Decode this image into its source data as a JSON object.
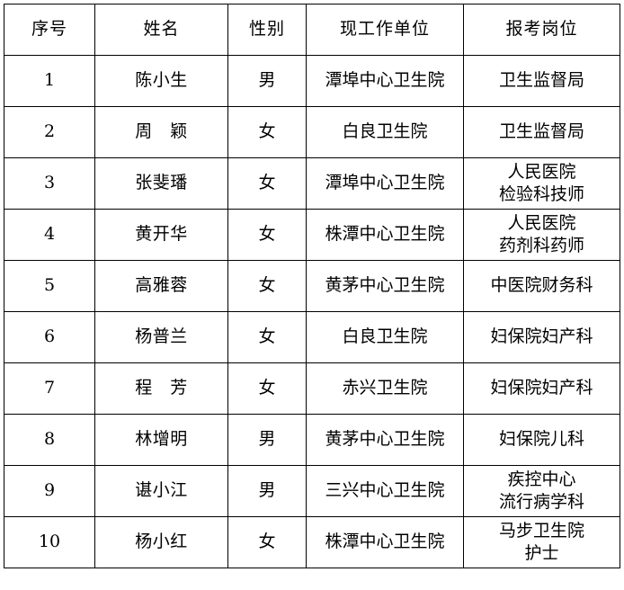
{
  "table": {
    "columns": [
      {
        "key": "seq",
        "label": "序号"
      },
      {
        "key": "name",
        "label": "姓名"
      },
      {
        "key": "gender",
        "label": "性别"
      },
      {
        "key": "unit",
        "label": "现工作单位"
      },
      {
        "key": "post",
        "label": "报考岗位"
      }
    ],
    "rows": [
      {
        "seq": "1",
        "name": "陈小生",
        "gender": "男",
        "unit": "潭埠中心卫生院",
        "post_lines": [
          "卫生监督局"
        ]
      },
      {
        "seq": "2",
        "name": "周　颖",
        "gender": "女",
        "unit": "白良卫生院",
        "post_lines": [
          "卫生监督局"
        ]
      },
      {
        "seq": "3",
        "name": "张斐璠",
        "gender": "女",
        "unit": "潭埠中心卫生院",
        "post_lines": [
          "人民医院",
          "检验科技师"
        ]
      },
      {
        "seq": "4",
        "name": "黄开华",
        "gender": "女",
        "unit": "株潭中心卫生院",
        "post_lines": [
          "人民医院",
          "药剂科药师"
        ]
      },
      {
        "seq": "5",
        "name": "高雅蓉",
        "gender": "女",
        "unit": "黄茅中心卫生院",
        "post_lines": [
          "中医院财务科"
        ]
      },
      {
        "seq": "6",
        "name": "杨普兰",
        "gender": "女",
        "unit": "白良卫生院",
        "post_lines": [
          "妇保院妇产科"
        ]
      },
      {
        "seq": "7",
        "name": "程　芳",
        "gender": "女",
        "unit": "赤兴卫生院",
        "post_lines": [
          "妇保院妇产科"
        ]
      },
      {
        "seq": "8",
        "name": "林增明",
        "gender": "男",
        "unit": "黄茅中心卫生院",
        "post_lines": [
          "妇保院儿科"
        ]
      },
      {
        "seq": "9",
        "name": "谌小江",
        "gender": "男",
        "unit": "三兴中心卫生院",
        "post_lines": [
          "疾控中心",
          "流行病学科"
        ]
      },
      {
        "seq": "10",
        "name": "杨小红",
        "gender": "女",
        "unit": "株潭中心卫生院",
        "post_lines": [
          "马步卫生院",
          "护士"
        ]
      }
    ]
  }
}
